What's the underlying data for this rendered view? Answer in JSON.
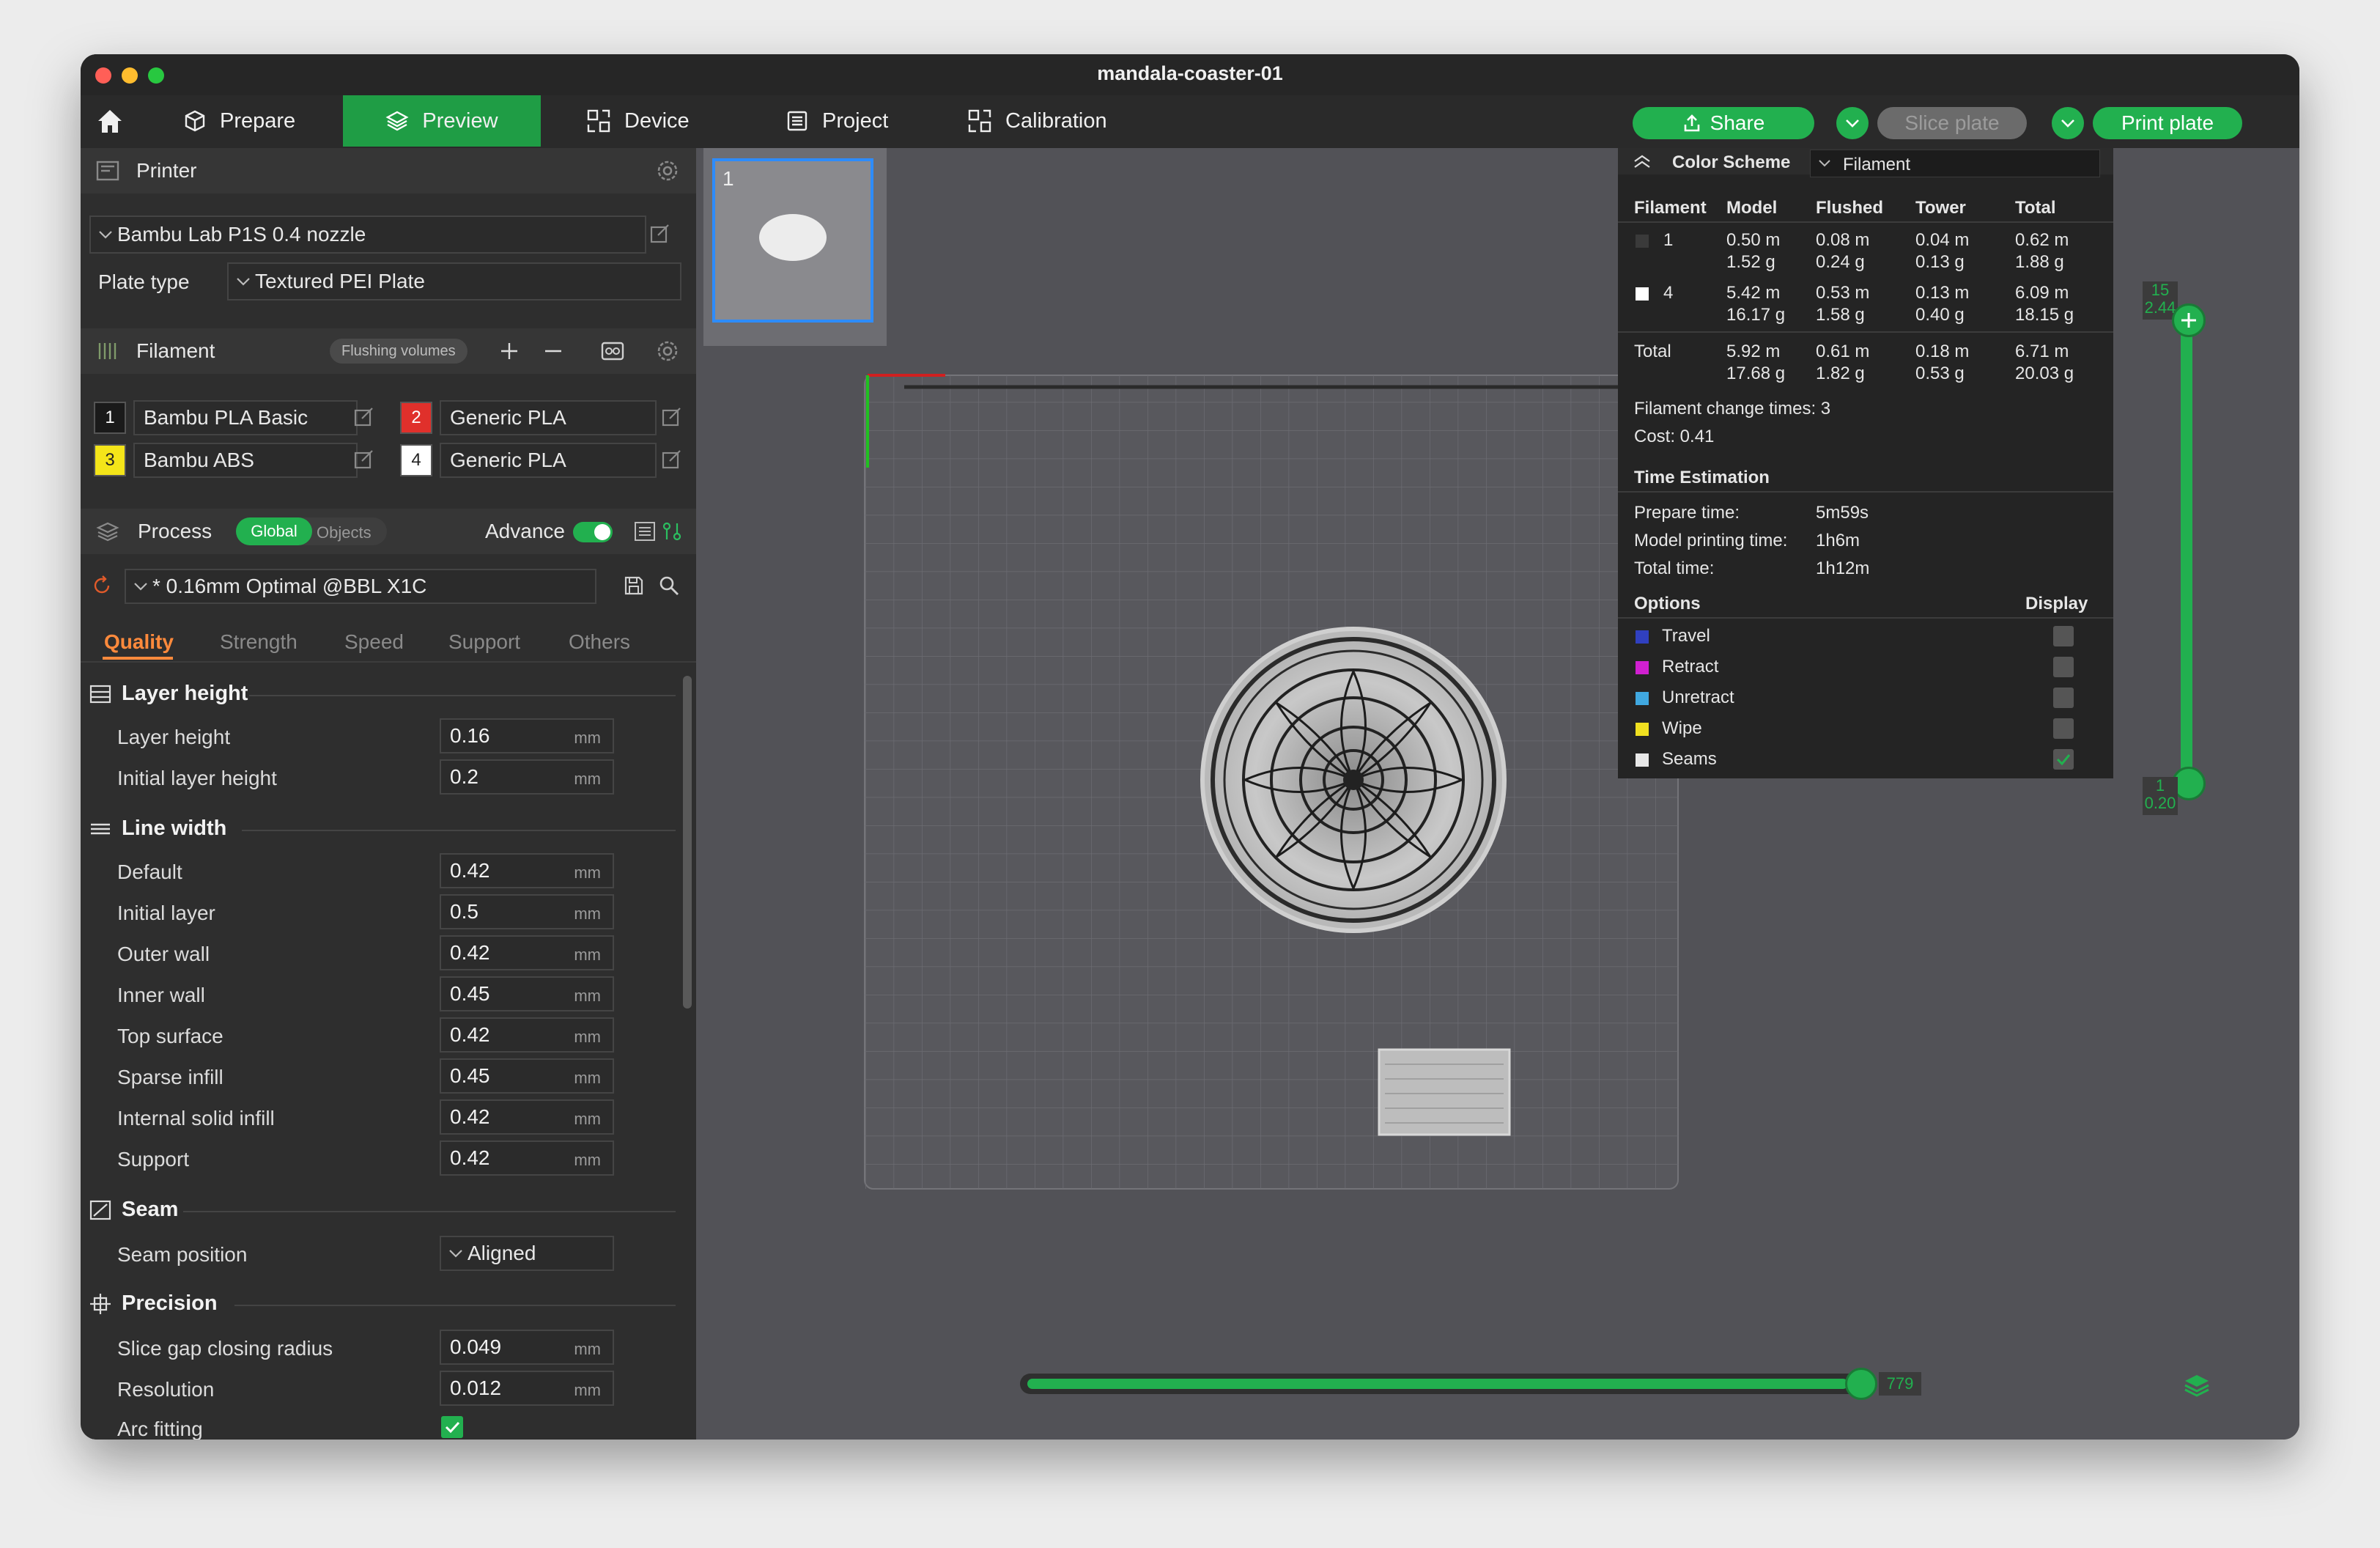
{
  "window": {
    "title": "mandala-coaster-01"
  },
  "topbar": {
    "tabs": [
      {
        "label": "Prepare"
      },
      {
        "label": "Preview"
      },
      {
        "label": "Device"
      },
      {
        "label": "Project"
      },
      {
        "label": "Calibration"
      }
    ],
    "share_label": "Share",
    "slice_label": "Slice plate",
    "print_label": "Print plate"
  },
  "printer": {
    "section_title": "Printer",
    "preset": "Bambu Lab P1S 0.4 nozzle",
    "plate_type_label": "Plate type",
    "plate_type": "Textured PEI Plate"
  },
  "filament": {
    "section_title": "Filament",
    "flushing_label": "Flushing volumes",
    "slots": [
      {
        "num": "1",
        "name": "Bambu PLA Basic",
        "color": "#1a1a1a"
      },
      {
        "num": "2",
        "name": "Generic PLA",
        "color": "#e0302b"
      },
      {
        "num": "3",
        "name": "Bambu ABS",
        "color": "#f4e519"
      },
      {
        "num": "4",
        "name": "Generic PLA",
        "color": "#ffffff"
      }
    ]
  },
  "process": {
    "section_title": "Process",
    "global_label": "Global",
    "objects_label": "Objects",
    "advance_label": "Advance",
    "preset": "* 0.16mm Optimal @BBL X1C",
    "tabs": [
      "Quality",
      "Strength",
      "Speed",
      "Support",
      "Others"
    ],
    "groups": {
      "layer_height": {
        "title": "Layer height",
        "rows": [
          {
            "label": "Layer height",
            "value": "0.16",
            "unit": "mm"
          },
          {
            "label": "Initial layer height",
            "value": "0.2",
            "unit": "mm"
          }
        ]
      },
      "line_width": {
        "title": "Line width",
        "rows": [
          {
            "label": "Default",
            "value": "0.42",
            "unit": "mm"
          },
          {
            "label": "Initial layer",
            "value": "0.5",
            "unit": "mm"
          },
          {
            "label": "Outer wall",
            "value": "0.42",
            "unit": "mm"
          },
          {
            "label": "Inner wall",
            "value": "0.45",
            "unit": "mm"
          },
          {
            "label": "Top surface",
            "value": "0.42",
            "unit": "mm"
          },
          {
            "label": "Sparse infill",
            "value": "0.45",
            "unit": "mm"
          },
          {
            "label": "Internal solid infill",
            "value": "0.42",
            "unit": "mm"
          },
          {
            "label": "Support",
            "value": "0.42",
            "unit": "mm"
          }
        ]
      },
      "seam": {
        "title": "Seam",
        "position_label": "Seam position",
        "position_value": "Aligned"
      },
      "precision": {
        "title": "Precision",
        "rows": [
          {
            "label": "Slice gap closing radius",
            "value": "0.049",
            "unit": "mm"
          },
          {
            "label": "Resolution",
            "value": "0.012",
            "unit": "mm"
          }
        ],
        "arc_label": "Arc fitting"
      }
    }
  },
  "plate": {
    "number": "1"
  },
  "legend": {
    "scheme_label": "Color Scheme",
    "scheme_value": "Filament",
    "headers": [
      "Filament",
      "Model",
      "Flushed",
      "Tower",
      "Total"
    ],
    "rows": [
      {
        "id": "1",
        "swatch": "#2a2a2a",
        "model": [
          "0.50 m",
          "1.52 g"
        ],
        "flushed": [
          "0.08 m",
          "0.24 g"
        ],
        "tower": [
          "0.04 m",
          "0.13 g"
        ],
        "total": [
          "0.62 m",
          "1.88 g"
        ]
      },
      {
        "id": "4",
        "swatch": "#ffffff",
        "model": [
          "5.42 m",
          "16.17 g"
        ],
        "flushed": [
          "0.53 m",
          "1.58 g"
        ],
        "tower": [
          "0.13 m",
          "0.40 g"
        ],
        "total": [
          "6.09 m",
          "18.15 g"
        ]
      }
    ],
    "total_row": {
      "id": "Total",
      "model": [
        "5.92 m",
        "17.68 g"
      ],
      "flushed": [
        "0.61 m",
        "1.82 g"
      ],
      "tower": [
        "0.18 m",
        "0.53 g"
      ],
      "total": [
        "6.71 m",
        "20.03 g"
      ]
    },
    "change_times": "Filament change times:  3",
    "cost": "Cost:  0.41",
    "time_title": "Time Estimation",
    "times": [
      {
        "label": "Prepare time:",
        "value": "5m59s"
      },
      {
        "label": "Model printing time:",
        "value": "1h6m"
      },
      {
        "label": "Total time:",
        "value": "1h12m"
      }
    ],
    "options_label": "Options",
    "display_label": "Display",
    "options": [
      {
        "label": "Travel",
        "color": "#3040c0",
        "checked": false
      },
      {
        "label": "Retract",
        "color": "#d020d0",
        "checked": false
      },
      {
        "label": "Unretract",
        "color": "#40a8e0",
        "checked": false
      },
      {
        "label": "Wipe",
        "color": "#f0e020",
        "checked": false
      },
      {
        "label": "Seams",
        "color": "#e8e8e8",
        "checked": true
      }
    ]
  },
  "layer_slider": {
    "top_layer": "15",
    "top_height": "2.44",
    "bottom_layer": "1",
    "bottom_height": "0.20"
  },
  "move_slider": {
    "value": "779"
  }
}
